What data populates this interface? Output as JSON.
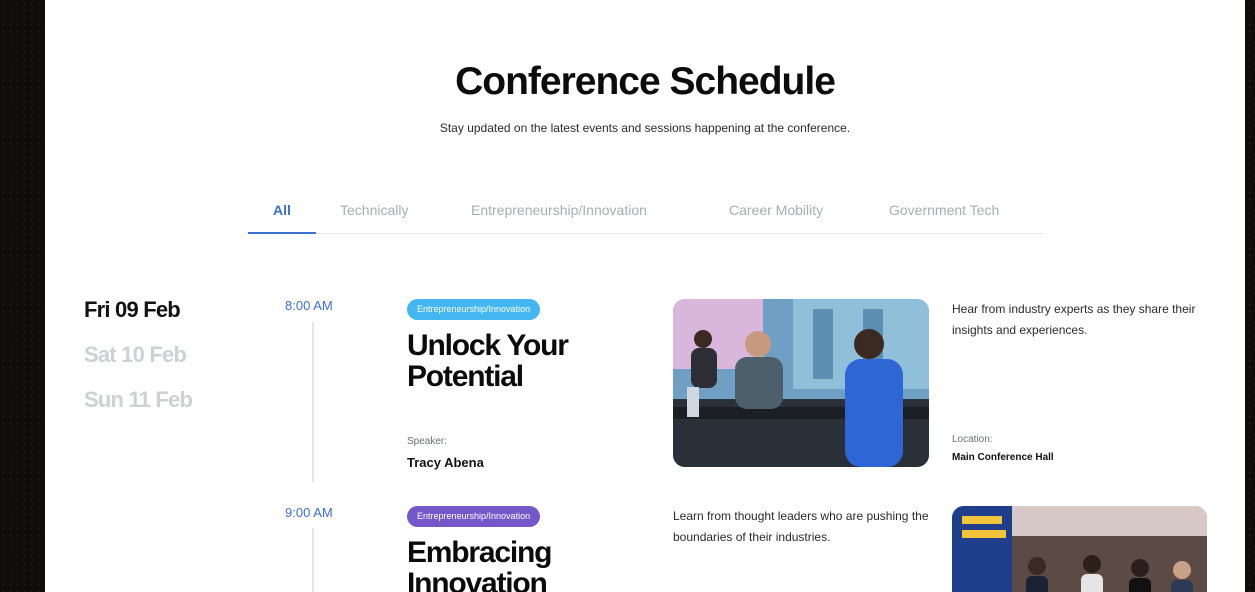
{
  "header": {
    "title": "Conference Schedule",
    "subtitle": "Stay updated on the latest events and sessions happening at the conference."
  },
  "tabs": [
    {
      "label": "All",
      "active": true
    },
    {
      "label": "Technically",
      "active": false
    },
    {
      "label": "Entrepreneurship/Innovation",
      "active": false
    },
    {
      "label": "Career Mobility",
      "active": false
    },
    {
      "label": "Government Tech",
      "active": false
    }
  ],
  "days": [
    {
      "label": "Fri 09 Feb",
      "active": true
    },
    {
      "label": "Sat 10 Feb",
      "active": false
    },
    {
      "label": "Sun 11 Feb",
      "active": false
    }
  ],
  "sessions": [
    {
      "time": "8:00 AM",
      "tag": "Entrepreneurship/Innovation",
      "tag_color": "#44b6f2",
      "title": "Unlock Your Potential",
      "speaker_label": "Speaker:",
      "speaker": "Tracy Abena",
      "description": "Hear from industry experts as they share their insights and experiences.",
      "location_label": "Location:",
      "location": "Main Conference Hall",
      "image": "photo of attendees talking at a table"
    },
    {
      "time": "9:00 AM",
      "tag": "Entrepreneurship/Innovation",
      "tag_color": "#7457c9",
      "title": "Embracing Innovation",
      "description": "Learn from thought leaders who are pushing the boundaries of their industries.",
      "image": "photo of panel speakers on stage"
    }
  ],
  "colors": {
    "accent": "#3b6fd1",
    "tag_blue": "#44b6f2",
    "tag_purple": "#7457c9",
    "inactive_day": "#cdd0d5",
    "inactive_tab": "#a9adb3"
  }
}
